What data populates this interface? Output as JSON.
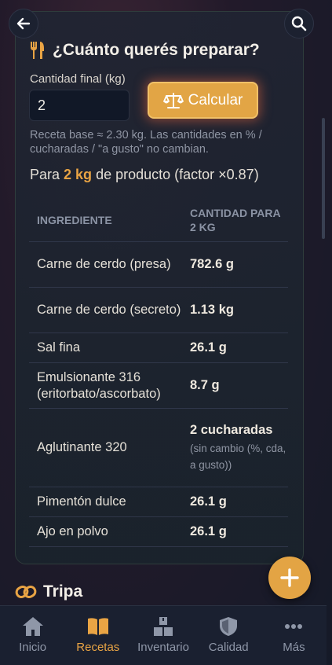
{
  "header": {
    "back_icon": "arrow-left-icon",
    "search_icon": "search-icon"
  },
  "calculator": {
    "icon": "utensils-icon",
    "title": "¿Cuánto querés preparar?",
    "qty_label": "Cantidad final (kg)",
    "qty_value": "2",
    "calc_icon": "scale-icon",
    "calc_label": "Calcular",
    "note": "Receta base ≈ 2.30 kg. Las cantidades en % / cucharadas / \"a gusto\" no cambian.",
    "factor_prefix": "Para ",
    "factor_highlight": "2 kg",
    "factor_suffix": " de producto (factor ×0.87)"
  },
  "table": {
    "headers": [
      "INGREDIENTE",
      "CANTIDAD PARA 2 KG"
    ],
    "rows": [
      {
        "ingredient": "Carne de cerdo (presa)",
        "amount": "782.6 g"
      },
      {
        "ingredient": "Carne de cerdo (secreto)",
        "amount": "1.13 kg"
      },
      {
        "ingredient": "Sal fina",
        "amount": "26.1 g"
      },
      {
        "ingredient": "Emulsionante 316 (eritorbato/ascorbato)",
        "amount": "8.7 g"
      },
      {
        "ingredient": "Aglutinante 320",
        "amount": "2 cucharadas",
        "note": "(sin cambio (%, cda, a gusto))"
      },
      {
        "ingredient": "Pimentón dulce",
        "amount": "26.1 g"
      },
      {
        "ingredient": "Ajo en polvo",
        "amount": "26.1 g"
      }
    ]
  },
  "fab": {
    "icon": "plus-icon"
  },
  "section2": {
    "icon": "link-icon",
    "title": "Tripa"
  },
  "nav": {
    "items": [
      {
        "label": "Inicio",
        "icon": "home-icon"
      },
      {
        "label": "Recetas",
        "icon": "book-icon",
        "active": true
      },
      {
        "label": "Inventario",
        "icon": "boxes-icon"
      },
      {
        "label": "Calidad",
        "icon": "shield-icon"
      },
      {
        "label": "Más",
        "icon": "more-icon"
      }
    ]
  },
  "colors": {
    "accent": "#e9a444",
    "background": "#151a28"
  }
}
